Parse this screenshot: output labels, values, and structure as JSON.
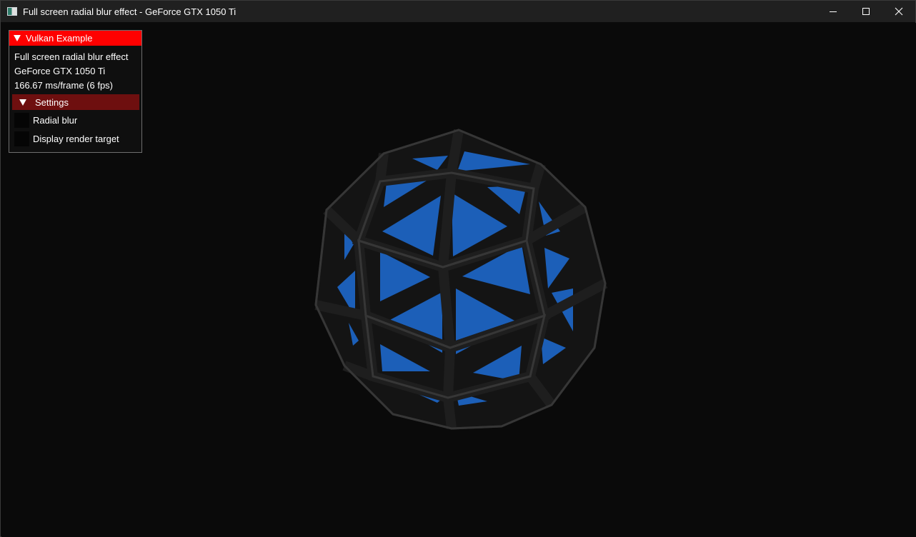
{
  "window": {
    "title": "Full screen radial blur effect - GeForce GTX 1050 Ti",
    "icon": "app-icon",
    "controls": [
      "minimize-icon",
      "maximize-icon",
      "close-icon"
    ]
  },
  "overlay": {
    "header": "Vulkan Example",
    "lines": [
      "Full screen radial blur effect",
      "GeForce GTX 1050 Ti",
      "166.67 ms/frame (6 fps)"
    ],
    "settings_header": "Settings",
    "checkboxes": [
      {
        "label": "Radial blur",
        "checked": false
      },
      {
        "label": "Display render target",
        "checked": false
      }
    ]
  },
  "colors": {
    "header_red": "#ff0000",
    "settings_red": "#6e0f0f",
    "model_blue": "#1c5fb8",
    "background": "#0a0a0a"
  }
}
